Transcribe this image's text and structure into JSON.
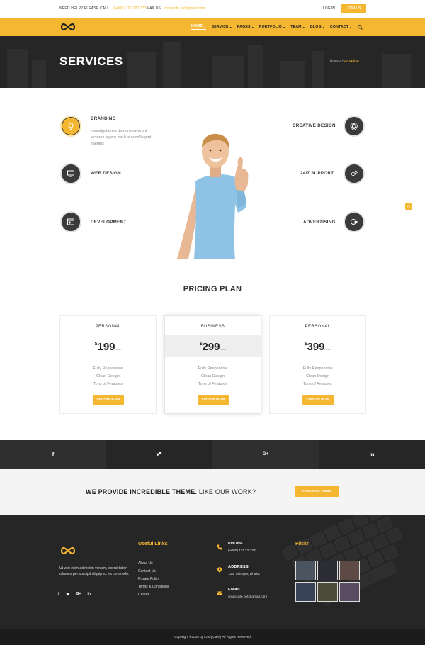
{
  "topbar": {
    "help_label": "NEED HELP? PLEASE CALL",
    "help_phone": "(+000) 111 222 333",
    "mail_label": "MAIL US",
    "mail_address": "crazycafe.net@gmail.com",
    "login": "LOG IN",
    "join": "JOIN US"
  },
  "nav": {
    "items": [
      {
        "label": "HOME"
      },
      {
        "label": "SERVICE"
      },
      {
        "label": "PAGES"
      },
      {
        "label": "PORTFOLIO"
      },
      {
        "label": "TEAM"
      },
      {
        "label": "BLOG"
      },
      {
        "label": "CONTACT"
      }
    ]
  },
  "hero": {
    "title": "SERVICES",
    "breadcrumb_home": "home",
    "breadcrumb_sep": "/",
    "breadcrumb_current": "serveice"
  },
  "services": {
    "left": [
      {
        "title": "BRANDING",
        "text": "Investigationes demonstraverunt lectores legere me lius quod legunt saepius"
      },
      {
        "title": "WEB DESIGN"
      },
      {
        "title": "DEVELOPMENT"
      }
    ],
    "right": [
      {
        "title": "CREATIVE DESIGN"
      },
      {
        "title": "24/7 SUPPORT"
      },
      {
        "title": "ADVERTISING"
      }
    ]
  },
  "pricing": {
    "title": "PRICING PLAN",
    "plans": [
      {
        "name": "PERSONAL",
        "currency": "$",
        "amount": "199",
        "period": "/mon",
        "features": [
          "Fully Responsive",
          "Clean Design",
          "Tons of Features"
        ],
        "cta": "CHOOSE PLAN"
      },
      {
        "name": "BUSINESS",
        "currency": "$",
        "amount": "299",
        "period": "/mon",
        "features": [
          "Fully Responsive",
          "Clean Design",
          "Tons of Features"
        ],
        "cta": "CHOOSE PLAN"
      },
      {
        "name": "PERSONAL",
        "currency": "$",
        "amount": "399",
        "period": "/mon",
        "features": [
          "Fully Responsive",
          "Clean Design",
          "Tons of Features"
        ],
        "cta": "CHOOSE PLAN"
      }
    ]
  },
  "social": {
    "facebook": "f",
    "twitter": "twitter",
    "google": "G+",
    "linkedin": "in"
  },
  "cta": {
    "bold": "WE PROVIDE INCREDIBLE THEME.",
    "rest": " LIKE OUR WORK?",
    "button": "PURCHASE THEME"
  },
  "footer": {
    "about": "Ut wisi enim ad minim veniam, exerci tation ullamcorper suscipit aliquip ex ea commodo.",
    "social": [
      "f",
      "twitter",
      "G+",
      "in"
    ],
    "links_title": "Useful Links",
    "links": [
      "About Us",
      "Contact Us",
      "Private Policy",
      "Terms & Conditions",
      "Career"
    ],
    "phone_label": "PHONE",
    "phone_value": "(+000) 111 22 333",
    "address_label": "ADDRESS",
    "address_value": "123, Sismpur, Dhaka",
    "email_label": "EMAIL",
    "email_value": "crazycafe.net@gmail.com",
    "flickr_title": "Flickr",
    "copyright": "Copyright ©2016 by CrazyCafe   |   All Rights Reserved"
  },
  "colors": {
    "accent": "#f5b731",
    "dark": "#262626"
  }
}
